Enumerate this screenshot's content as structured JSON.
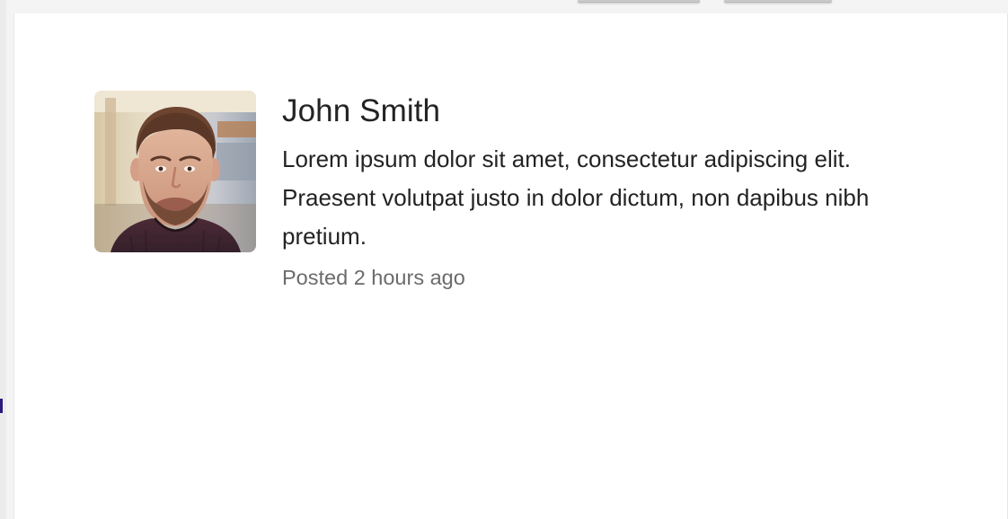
{
  "post": {
    "author": "John Smith",
    "body": "Lorem ipsum dolor sit amet, consectetur adipiscing elit. Praesent volutpat justo in dolor dictum, non dapibus nibh pretium.",
    "posted": "Posted 2 hours ago"
  },
  "colors": {
    "text": "#232323",
    "muted": "#6b6b6b",
    "page_background": "#f4f4f4",
    "card_background": "#ffffff"
  }
}
